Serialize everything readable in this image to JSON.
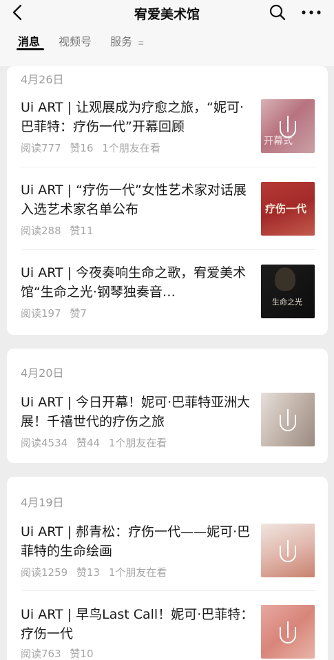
{
  "header": {
    "title": "宥爱美术馆",
    "back_icon": "chevron-left-icon",
    "search_icon": "search-icon",
    "more_icon": "more-icon"
  },
  "tabs": [
    {
      "label": "消息",
      "active": true
    },
    {
      "label": "视频号",
      "active": false
    },
    {
      "label": "服务",
      "active": false
    }
  ],
  "groups": [
    {
      "date": "4月26日",
      "articles": [
        {
          "title": "Ui ART | 让观展成为疗愈之旅，“妮可·巴菲特：疗伤一代”开幕回顾",
          "reads": "阅读777",
          "likes": "赞16",
          "friends": "1个朋友在看",
          "thumb_text": "开幕式"
        },
        {
          "title": "Ui ART | “疗伤一代”女性艺术家对话展入选艺术家名单公布",
          "reads": "阅读288",
          "likes": "赞11",
          "friends": "",
          "thumb_text": "疗伤一代"
        },
        {
          "title": "Ui ART | 今夜奏响生命之歌，宥爱美术馆“生命之光·钢琴独奏音…",
          "reads": "阅读197",
          "likes": "赞7",
          "friends": "",
          "thumb_text": "生命之光"
        }
      ]
    },
    {
      "date": "4月20日",
      "articles": [
        {
          "title": "Ui ART | 今日开幕！妮可·巴菲特亚洲大展！千禧世代的疗伤之旅",
          "reads": "阅读4534",
          "likes": "赞44",
          "friends": "1个朋友在看",
          "thumb_text": ""
        }
      ]
    },
    {
      "date": "4月19日",
      "articles": [
        {
          "title": "Ui ART | 郝青松：疗伤一代——妮可·巴菲特的生命绘画",
          "reads": "阅读1259",
          "likes": "赞13",
          "friends": "1个朋友在看",
          "thumb_text": ""
        },
        {
          "title": "Ui ART | 早鸟Last Call！妮可·巴菲特：疗伤一代",
          "reads": "阅读763",
          "likes": "赞10",
          "friends": "",
          "thumb_text": ""
        }
      ]
    }
  ],
  "colors": {
    "background": "#ededed",
    "card": "#ffffff",
    "meta_text": "#a6a6a6",
    "date_text": "#9a9a9a"
  }
}
